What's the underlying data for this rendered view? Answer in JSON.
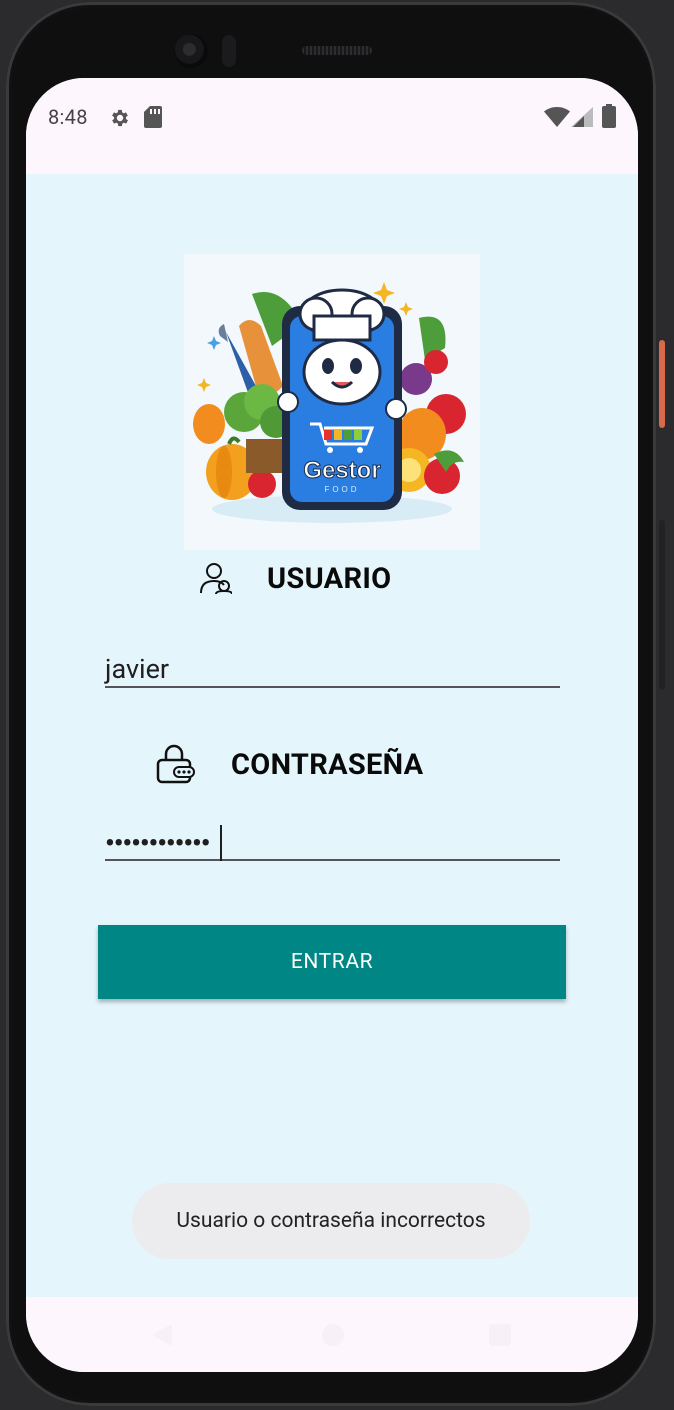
{
  "statusbar": {
    "time": "8:48",
    "icons": [
      "gear-icon",
      "sd-card-icon",
      "wifi-icon",
      "cell-signal-icon",
      "battery-icon"
    ]
  },
  "login": {
    "logo": {
      "line1": "Gestor",
      "line2": "FOOD"
    },
    "user_label": "USUARIO",
    "user_value": "javier",
    "password_label": "CONTRASEÑA",
    "password_value": "••••••••••••",
    "submit_label": "ENTRAR"
  },
  "toast": {
    "message": "Usuario o contraseña incorrectos"
  },
  "navbar": {
    "icons": [
      "back-icon",
      "home-icon",
      "recents-icon"
    ]
  },
  "colors": {
    "background": "#e4f5fb",
    "button": "#008785",
    "statusbar": "#fdf6fd",
    "toast": "#ececee"
  }
}
